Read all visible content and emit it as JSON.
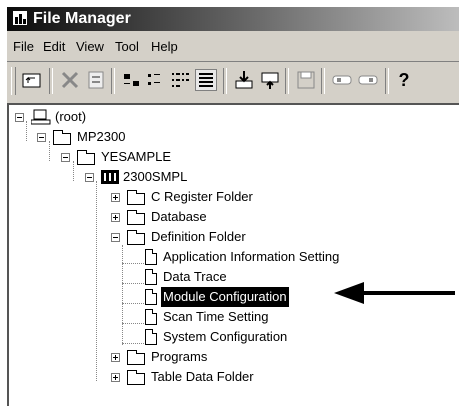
{
  "window": {
    "title": "File Manager"
  },
  "menu": [
    "File",
    "Edit",
    "View",
    "Tool",
    "Help"
  ],
  "toolbar_icons": [
    "up-folder-icon",
    "cut-icon",
    "properties-icon",
    "large-icons-icon",
    "small-icons-icon",
    "list-icon",
    "details-icon",
    "download-icon",
    "upload-icon",
    "save-icon",
    "link-icon",
    "link2-icon",
    "help-icon"
  ],
  "tree": {
    "root": "(root)",
    "mp2300": "MP2300",
    "yesample": "YESAMPLE",
    "smpl": "2300SMPL",
    "c_register": "C Register Folder",
    "database": "Database",
    "definition": "Definition Folder",
    "app_info": "Application Information Setting",
    "data_trace": "Data Trace",
    "module_config": "Module Configuration",
    "scan_time": "Scan Time Setting",
    "system_config": "System Configuration",
    "programs": "Programs",
    "table_data": "Table Data Folder"
  }
}
